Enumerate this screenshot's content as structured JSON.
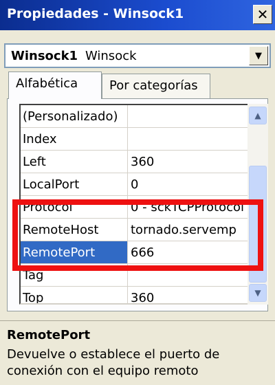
{
  "window": {
    "title": "Propiedades - Winsock1",
    "close_glyph": "✕"
  },
  "object_selector": {
    "name": "Winsock1",
    "type": "Winsock"
  },
  "tabs": [
    {
      "label": "Alfabética",
      "active": true
    },
    {
      "label": "Por categorías",
      "active": false
    }
  ],
  "properties": [
    {
      "name": "(Personalizado)",
      "value": ""
    },
    {
      "name": "Index",
      "value": ""
    },
    {
      "name": "Left",
      "value": "360"
    },
    {
      "name": "LocalPort",
      "value": "0"
    },
    {
      "name": "Protocol",
      "value": "0 - sckTCPProtocol"
    },
    {
      "name": "RemoteHost",
      "value": "tornado.servemp"
    },
    {
      "name": "RemotePort",
      "value": "666",
      "selected": true
    },
    {
      "name": "Tag",
      "value": ""
    },
    {
      "name": "Top",
      "value": "360"
    }
  ],
  "description": {
    "title": "RemotePort",
    "text": "Devuelve o establece el puerto de conexión con el equipo remoto"
  },
  "colors": {
    "highlight_box": "#ee1111",
    "selection": "#316ac5",
    "titlebar": "#0b2d8f"
  }
}
